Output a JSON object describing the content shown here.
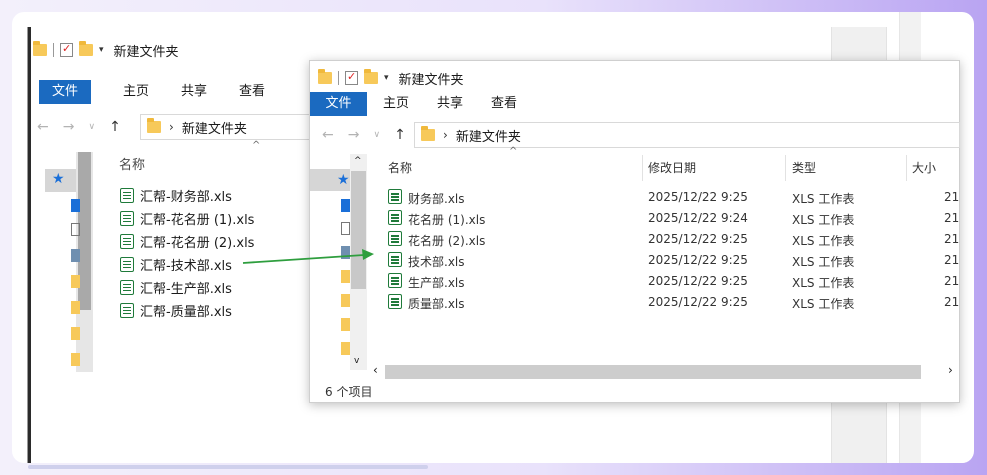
{
  "back_window": {
    "title": "新建文件夹",
    "tabs": [
      "文件",
      "主页",
      "共享",
      "查看"
    ],
    "address_path": "新建文件夹",
    "column_name": "名称",
    "files": [
      "汇帮-财务部.xls",
      "汇帮-花名册 (1).xls",
      "汇帮-花名册 (2).xls",
      "汇帮-技术部.xls",
      "汇帮-生产部.xls",
      "汇帮-质量部.xls"
    ]
  },
  "front_window": {
    "title": "新建文件夹",
    "tabs": [
      "文件",
      "主页",
      "共享",
      "查看"
    ],
    "address_path": "新建文件夹",
    "columns": {
      "name": "名称",
      "modified": "修改日期",
      "type": "类型",
      "size": "大小"
    },
    "files": [
      {
        "name": "财务部.xls",
        "modified": "2025/12/22 9:25",
        "type": "XLS 工作表",
        "size": "21"
      },
      {
        "name": "花名册 (1).xls",
        "modified": "2025/12/22 9:24",
        "type": "XLS 工作表",
        "size": "21"
      },
      {
        "name": "花名册 (2).xls",
        "modified": "2025/12/22 9:25",
        "type": "XLS 工作表",
        "size": "21"
      },
      {
        "name": "技术部.xls",
        "modified": "2025/12/22 9:25",
        "type": "XLS 工作表",
        "size": "21"
      },
      {
        "name": "生产部.xls",
        "modified": "2025/12/22 9:25",
        "type": "XLS 工作表",
        "size": "21"
      },
      {
        "name": "质量部.xls",
        "modified": "2025/12/22 9:25",
        "type": "XLS 工作表",
        "size": "21"
      }
    ],
    "status": "6 个项目"
  },
  "colors": {
    "accent": "#1b6ac0",
    "arrow": "#2e9e3e",
    "folder": "#f7c95a",
    "file_icon": "#1f7a3a"
  }
}
